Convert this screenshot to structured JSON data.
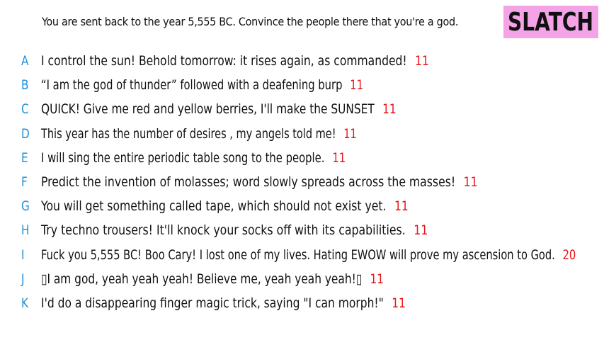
{
  "prompt": "You are sent back to the year 5,555 BC. Convince the people there that you're a god.",
  "logo": {
    "text": "SLATCH",
    "background": "#f3a3e6"
  },
  "colors": {
    "letter": "#1e90d6",
    "score": "#e8141a",
    "text": "#111111"
  },
  "answers": [
    {
      "letter": "A",
      "text": "I control the sun! Behold tomorrow: it rises again, as commanded!",
      "score": "11"
    },
    {
      "letter": "B",
      "text": "“I am the god of thunder” followed with a deafening burp",
      "score": "11"
    },
    {
      "letter": "C",
      "text": "QUICK! Give me red and yellow berries, I'll make the SUNSET",
      "score": "11"
    },
    {
      "letter": "D",
      "text": "This year has the number of desires , my angels told me!",
      "score": "11"
    },
    {
      "letter": "E",
      "text": "I will sing the entire periodic table song to the people.",
      "score": "11"
    },
    {
      "letter": "F",
      "text": "Predict the invention of molasses; word slowly spreads across the masses!",
      "score": "11"
    },
    {
      "letter": "G",
      "text": "You will get something called tape, which should not exist yet.",
      "score": "11"
    },
    {
      "letter": "H",
      "text": "Try techno trousers! It'll knock your socks off with its capabilities.",
      "score": "11"
    },
    {
      "letter": "I",
      "text": "Fuck you 5,555 BC! Boo Cary! I lost one of my lives. Hating EWOW will prove my ascension to God.",
      "score": "20"
    },
    {
      "letter": "J",
      "text": "▯I am god, yeah yeah yeah! Believe me, yeah yeah yeah!▯",
      "score": "11"
    },
    {
      "letter": "K",
      "text": "I'd do a disappearing finger magic trick, saying \"I can morph!\"",
      "score": "11"
    }
  ]
}
